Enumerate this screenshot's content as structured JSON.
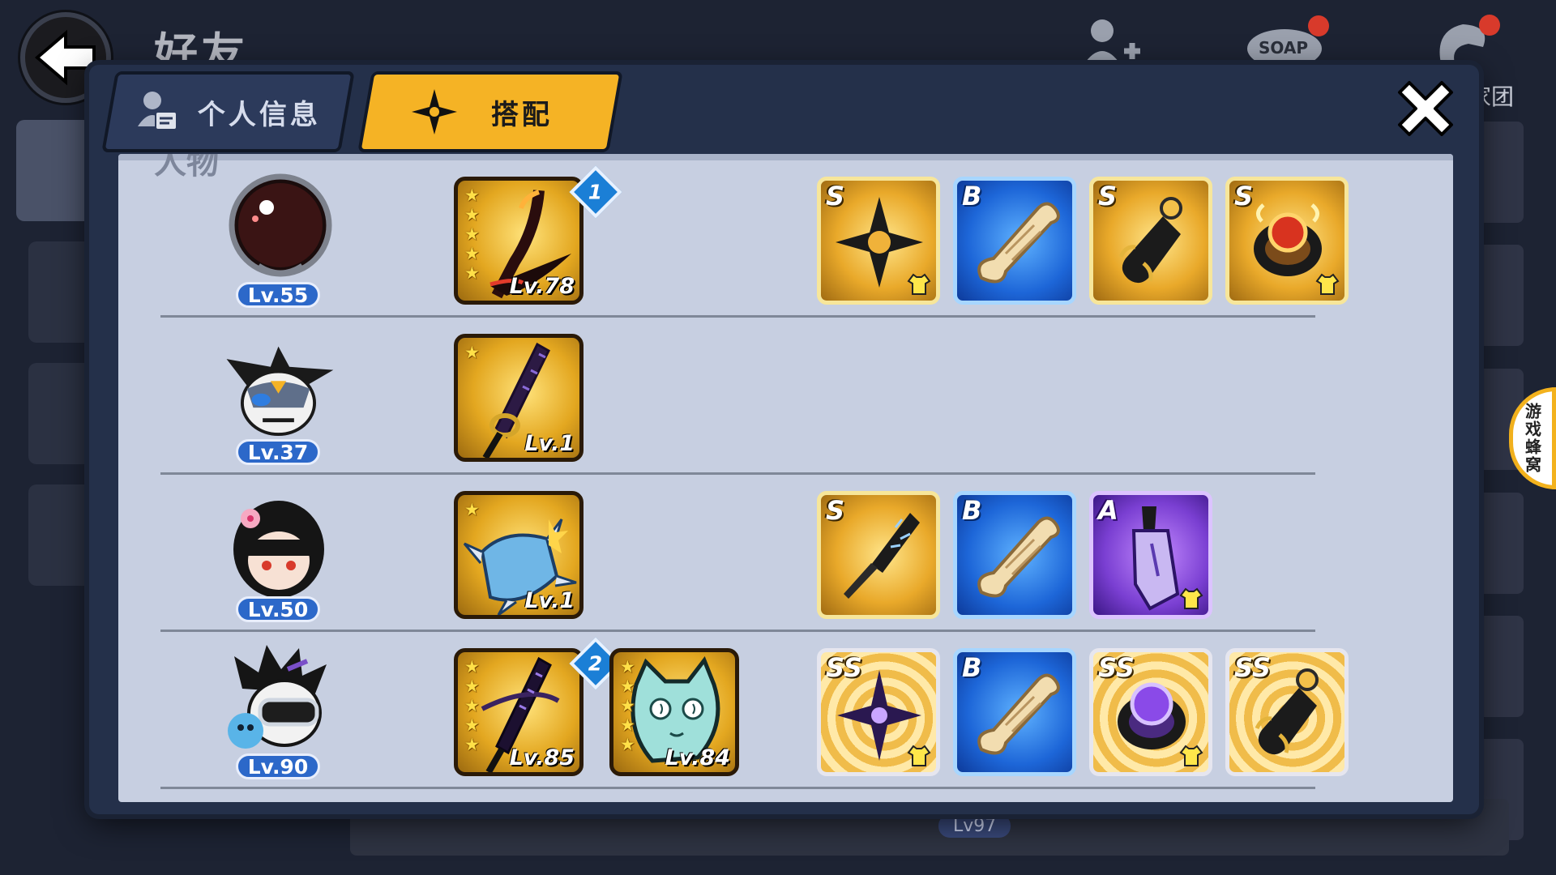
{
  "page": {
    "title": "好友",
    "guild_label": "家团",
    "bottom_lv": "Lv97",
    "side_promo": "游戏蜂窝"
  },
  "dialog": {
    "tabs": [
      {
        "label": "个人信息",
        "icon": "id-card-icon",
        "active": false
      },
      {
        "label": "搭配",
        "icon": "shuriken-icon",
        "active": true
      }
    ],
    "section_title": "人物",
    "close_icon": "close-icon"
  },
  "rows": [
    {
      "avatar": "dark-orb-ninja-avatar",
      "level": "Lv.55",
      "weapons": [
        {
          "name": "dark-scythe",
          "stars": 5,
          "level": "Lv.78",
          "gem": "1"
        }
      ],
      "equipment": [
        {
          "grade": "S",
          "item": "shuriken",
          "equipped_mark": true
        },
        {
          "grade": "B",
          "item": "scroll",
          "equipped_mark": false
        },
        {
          "grade": "S",
          "item": "gourd",
          "equipped_mark": false
        },
        {
          "grade": "S",
          "item": "ring",
          "equipped_mark": true
        }
      ]
    },
    {
      "avatar": "panda-masked-ninja-avatar",
      "level": "Lv.37",
      "weapons": [
        {
          "name": "katana",
          "stars": 1,
          "level": "Lv.1",
          "gem": ""
        }
      ],
      "equipment": []
    },
    {
      "avatar": "kunoichi-girl-avatar",
      "level": "Lv.50",
      "weapons": [
        {
          "name": "spiked-gauntlet",
          "stars": 1,
          "level": "Lv.1",
          "gem": ""
        }
      ],
      "equipment": [
        {
          "grade": "S",
          "item": "kunai",
          "equipped_mark": false
        },
        {
          "grade": "B",
          "item": "scroll",
          "equipped_mark": false
        },
        {
          "grade": "A",
          "item": "blade",
          "equipped_mark": true
        }
      ]
    },
    {
      "avatar": "goggles-ninja-avatar",
      "level": "Lv.90",
      "weapons": [
        {
          "name": "shadow-katana",
          "stars": 5,
          "level": "Lv.85",
          "gem": "2"
        },
        {
          "name": "spirit-cat",
          "stars": 5,
          "level": "Lv.84",
          "gem": ""
        }
      ],
      "equipment": [
        {
          "grade": "SS",
          "item": "shuriken",
          "equipped_mark": true
        },
        {
          "grade": "B",
          "item": "scroll",
          "equipped_mark": false
        },
        {
          "grade": "SS",
          "item": "ring",
          "equipped_mark": true
        },
        {
          "grade": "SS",
          "item": "gourd",
          "equipped_mark": false
        }
      ]
    }
  ],
  "colors": {
    "accent": "#f5b325",
    "level_badge": "#2c68c9",
    "panel": "#c7cfe1",
    "grade_s": "#e9a92a",
    "grade_b": "#1d66d8",
    "grade_a": "#7a3fd2"
  }
}
